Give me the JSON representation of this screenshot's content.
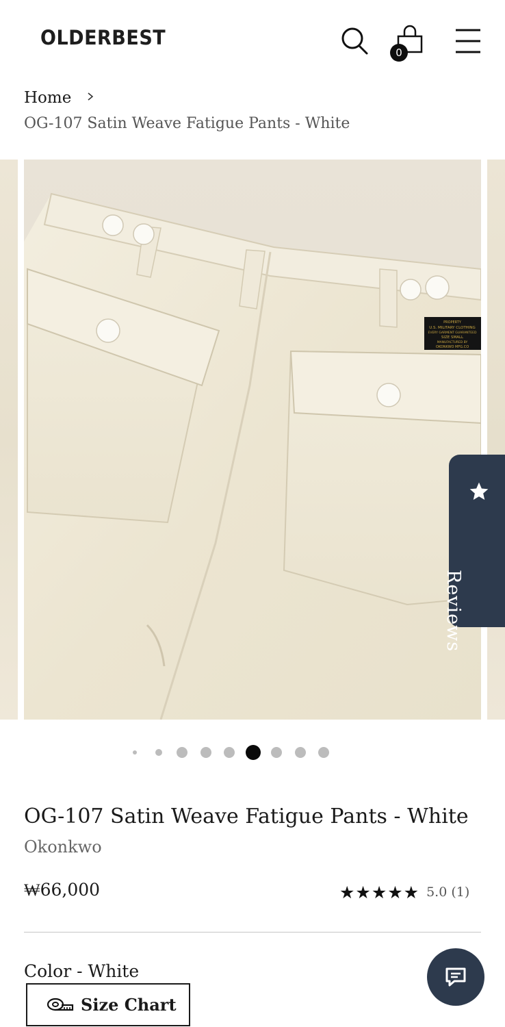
{
  "header": {
    "logo": "OLDERBEST",
    "cart_count": "0",
    "icons": [
      "search-icon",
      "cart-bag-icon",
      "menu-icon"
    ]
  },
  "breadcrumb": {
    "home": "Home",
    "current": "OG-107 Satin Weave Fatigue Pants - White"
  },
  "gallery": {
    "slide_count": 8,
    "active_index": 4,
    "label_lines": [
      "PROPERTY",
      "U.S. MILITARY CLOTHING",
      "EVERY GARMENT GUARANTEED",
      "SIZE   SMALL",
      "MANUFACTURED BY",
      "OKONKWO MFG.CO"
    ]
  },
  "reviews_tab": {
    "label": "Reviews"
  },
  "product": {
    "title": "OG-107 Satin Weave Fatigue Pants - White",
    "vendor": "Okonkwo",
    "price": "₩66,000",
    "rating_stars": "★★★★★",
    "rating_text": "5.0 (1)",
    "rating_value": 5.0,
    "color_label": "Color - White",
    "size_chart_label": "Size Chart"
  },
  "colors": {
    "accent_navy": "#2d3a4d",
    "fabric": "#eee8d6"
  }
}
